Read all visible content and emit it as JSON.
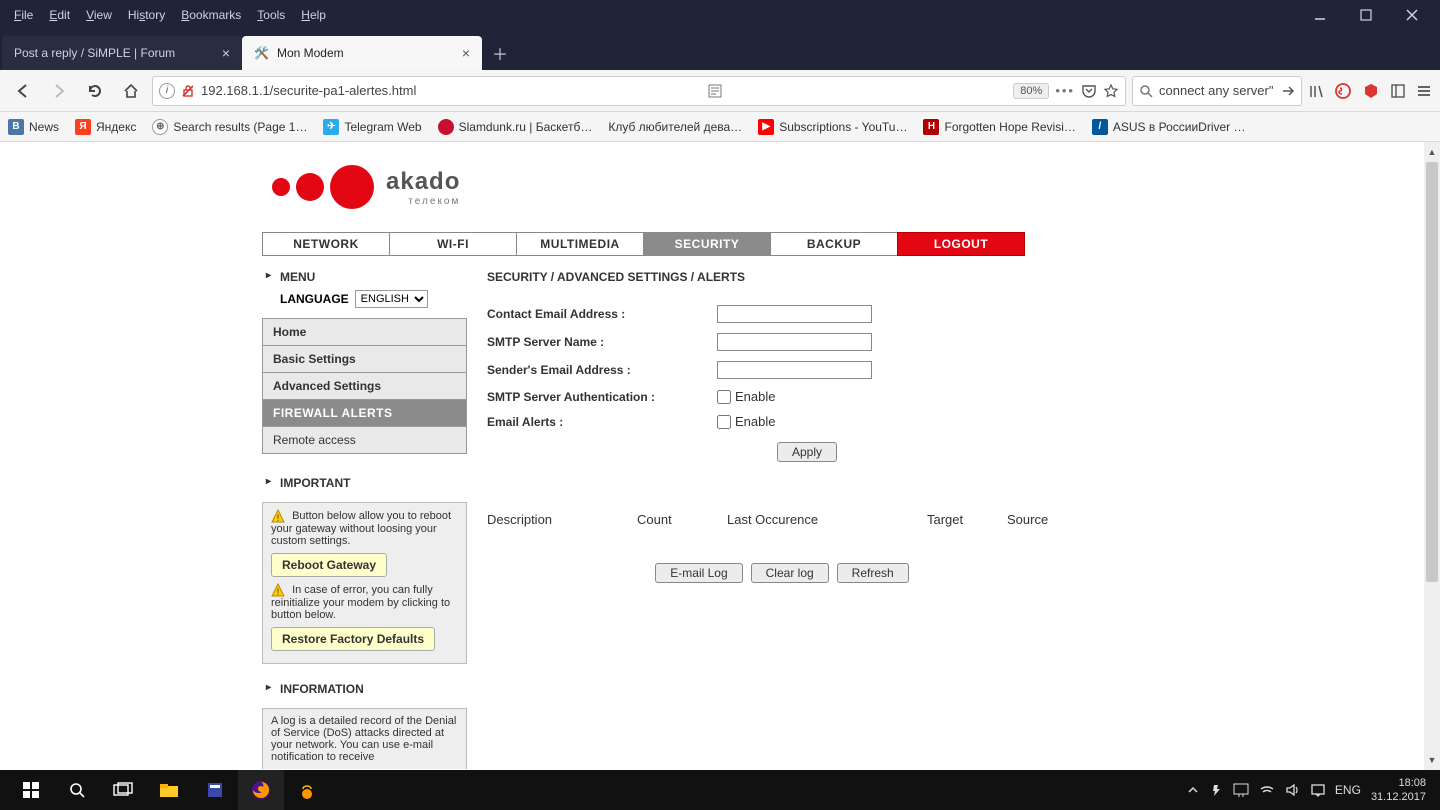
{
  "menubar": [
    "File",
    "Edit",
    "View",
    "History",
    "Bookmarks",
    "Tools",
    "Help"
  ],
  "tabs": [
    {
      "title": "Post a reply / SiMPLE | Forum",
      "active": false
    },
    {
      "title": "Mon Modem",
      "active": true
    }
  ],
  "url": "192.168.1.1/securite-pa1-alertes.html",
  "zoom": "80%",
  "search_placeholder": "connect any server\"",
  "bookmarks": [
    {
      "label": "News",
      "fav": "vk"
    },
    {
      "label": "Яндекс",
      "fav": "yx"
    },
    {
      "label": "Search results (Page 1…",
      "fav": "globe"
    },
    {
      "label": "Telegram Web",
      "fav": "tg"
    },
    {
      "label": "Slamdunk.ru | Баскетб…",
      "fav": "sd"
    },
    {
      "label": "Клуб любителей дева…",
      "fav": ""
    },
    {
      "label": "Subscriptions - YouTu…",
      "fav": "yt"
    },
    {
      "label": "Forgotten Hope Revisi…",
      "fav": "fh"
    },
    {
      "label": "ASUS в РоссииDriver …",
      "fav": "asus"
    }
  ],
  "logo": {
    "brand": "akado",
    "sub": "телеком"
  },
  "topnav": [
    "NETWORK",
    "WI-FI",
    "MULTIMEDIA",
    "SECURITY",
    "BACKUP",
    "LOGOUT"
  ],
  "topnav_active": "SECURITY",
  "side": {
    "menu_label": "MENU",
    "lang_label": "LANGUAGE",
    "lang_value": "ENGLISH",
    "items": [
      "Home",
      "Basic Settings",
      "Advanced Settings",
      "FIREWALL ALERTS",
      "Remote access"
    ],
    "active": "FIREWALL ALERTS",
    "important_label": "IMPORTANT",
    "important_text1": "Button below allow you to reboot your gateway without loosing your custom settings.",
    "btn_reboot": "Reboot Gateway",
    "important_text2": "In case of error, you can fully reinitialize your modem by clicking to button below.",
    "btn_restore": "Restore Factory Defaults",
    "info_label": "INFORMATION",
    "info_text": "A log is a detailed record of the Denial of Service (DoS) attacks directed at your network. You can use e-mail notification to receive"
  },
  "main": {
    "crumb": "SECURITY / ADVANCED SETTINGS / ALERTS",
    "fields": {
      "contact": "Contact Email Address :",
      "smtp": "SMTP Server Name :",
      "sender": "Sender's Email Address :",
      "auth": "SMTP Server Authentication :",
      "alerts": "Email Alerts :"
    },
    "enable": "Enable",
    "apply": "Apply",
    "log_headers": [
      "Description",
      "Count",
      "Last Occurence",
      "Target",
      "Source"
    ],
    "log_actions": [
      "E-mail Log",
      "Clear log",
      "Refresh"
    ]
  },
  "tray": {
    "lang": "ENG",
    "time": "18:08",
    "date": "31.12.2017"
  }
}
